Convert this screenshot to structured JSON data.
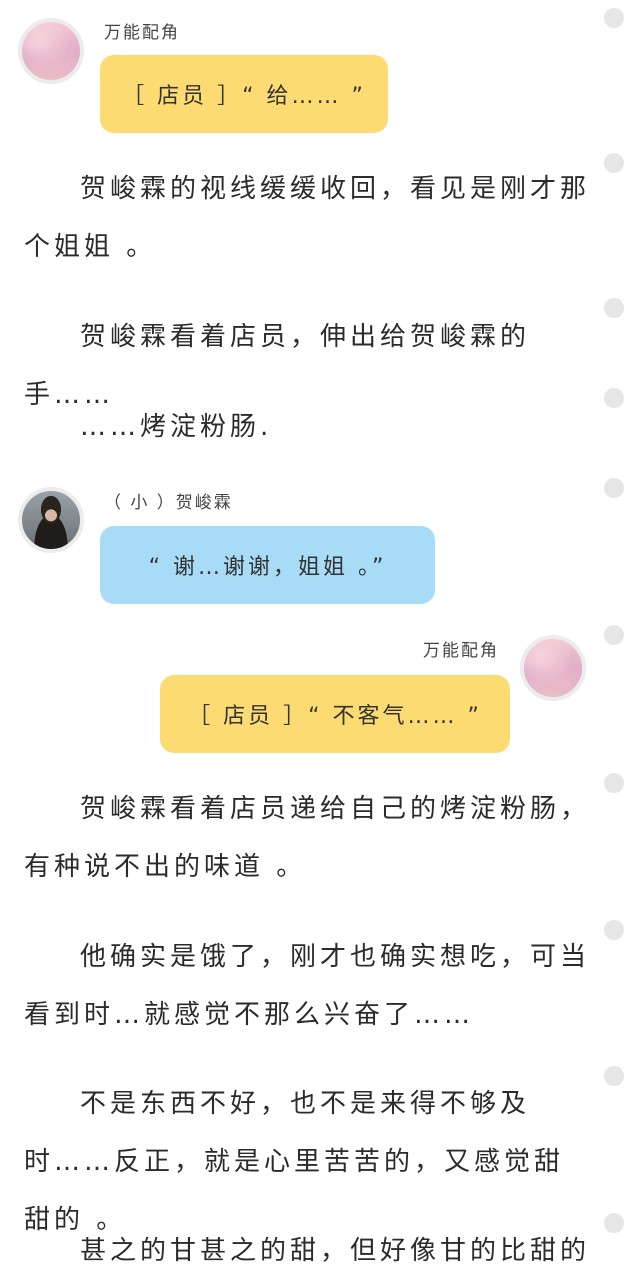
{
  "messages": [
    {
      "sender": "万能配角",
      "text": "［ 店员 ］“ 给…… ”"
    },
    {
      "sender": "（ 小 ）贺峻霖",
      "text": "“ 谢…谢谢，姐姐 。”"
    },
    {
      "sender": "万能配角",
      "text": "［ 店员 ］“ 不客气…… ”"
    }
  ],
  "paragraphs": [
    "贺峻霖的视线缓缓收回，看见是刚才那个姐姐 。",
    "贺峻霖看着店员，伸出给贺峻霖的手……",
    "……烤淀粉肠.",
    "贺峻霖看着店员递给自己的烤淀粉肠，有种说不出的味道 。",
    "他确实是饿了，刚才也确实想吃，可当看到时…就感觉不那么兴奋了……",
    "不是东西不好，也不是来得不够及时……反正，就是心里苦苦的，又感觉甜甜的 。",
    "甚之的甘甚之的甜，但好像甘的比甜的"
  ],
  "colors": {
    "bubble_yellow": "#fcdc72",
    "bubble_blue": "#a8dcf6",
    "dot": "#e6e6e6"
  },
  "icons": {
    "avatar_1": "pink-sky-avatar",
    "avatar_2": "boy-photo-avatar",
    "avatar_3": "pink-sky-avatar"
  }
}
